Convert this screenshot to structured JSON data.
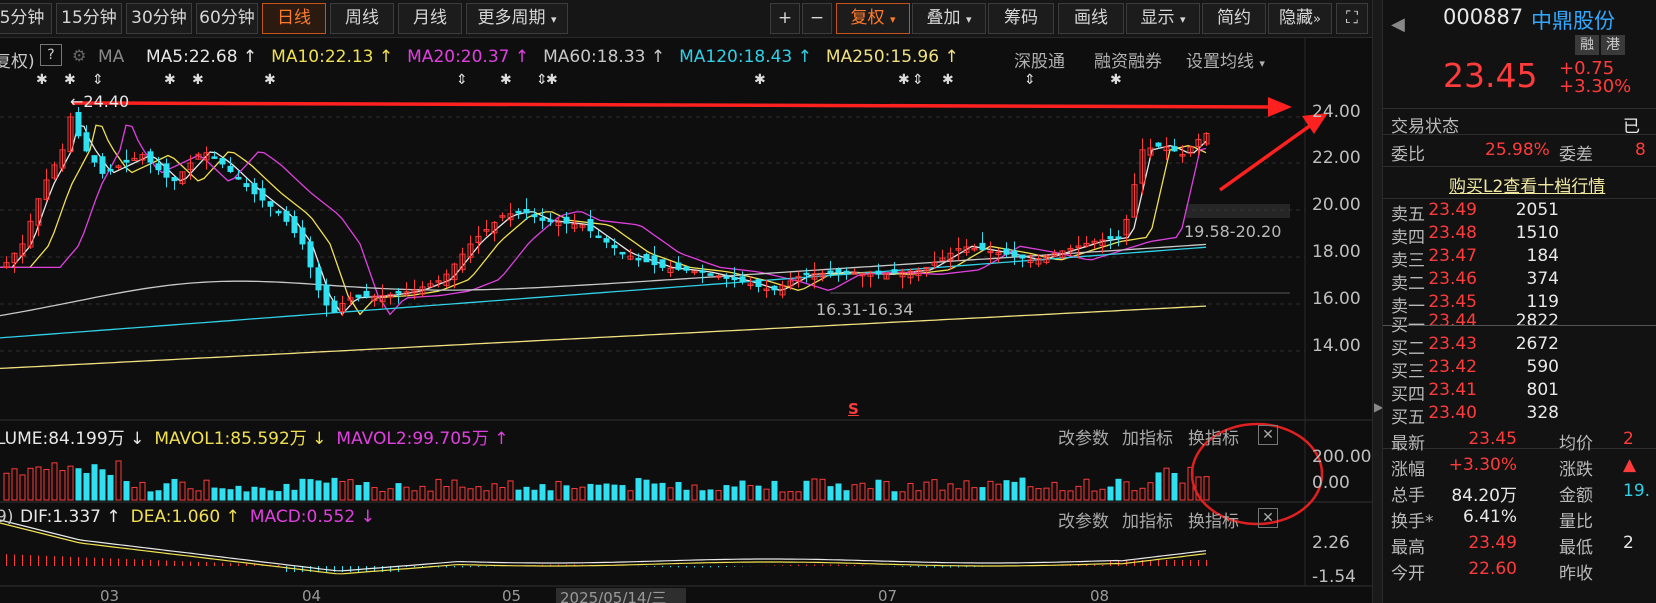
{
  "periods": {
    "items": [
      {
        "label": "5分钟"
      },
      {
        "label": "15分钟"
      },
      {
        "label": "30分钟"
      },
      {
        "label": "60分钟"
      },
      {
        "label": "日线"
      },
      {
        "label": "周线"
      },
      {
        "label": "月线"
      },
      {
        "label": "更多周期"
      }
    ],
    "active": "日线"
  },
  "toolbar": {
    "plus": "+",
    "minus": "−",
    "fuquan": "复权",
    "diejia": "叠加",
    "chouma": "筹码",
    "huaxian": "画线",
    "xianshi": "显示",
    "jianyue": "简约",
    "yincang": "隐藏"
  },
  "ma_legend": {
    "prefix": "复权)",
    "help": "?",
    "ma_label": "MA",
    "items": [
      {
        "text": "MA5:22.68",
        "arrow": "↑",
        "color": "#e8e8e8"
      },
      {
        "text": "MA10:22.13",
        "arrow": "↑",
        "color": "#f0e050"
      },
      {
        "text": "MA20:20.37",
        "arrow": "↑",
        "color": "#e040e0"
      },
      {
        "text": "MA60:18.33",
        "arrow": "↑",
        "color": "#c8c8c8"
      },
      {
        "text": "MA120:18.43",
        "arrow": "↑",
        "color": "#30d0e8"
      },
      {
        "text": "MA250:15.96",
        "arrow": "↑",
        "color": "#f0e080"
      }
    ],
    "links": [
      "深股通",
      "融资融券",
      "设置均线"
    ]
  },
  "price_axis": {
    "ticks": [
      "24.00",
      "22.00",
      "20.00",
      "18.00",
      "16.00",
      "14.00"
    ]
  },
  "annotations": {
    "high": "24.40",
    "zone1": "19.58-20.20",
    "zone2": "16.31-16.34",
    "s_mark": "S"
  },
  "volume": {
    "legend": [
      {
        "text": "LUME:84.199万",
        "arrow": "↓",
        "color": "#e8e8e8"
      },
      {
        "text": "MAVOL1:85.592万",
        "arrow": "↓",
        "color": "#f0e050"
      },
      {
        "text": "MAVOL2:99.705万",
        "arrow": "↑",
        "color": "#e040e0"
      }
    ],
    "ticks": [
      "200.00",
      "0.00"
    ],
    "buttons": [
      "改参数",
      "加指标",
      "换指标"
    ]
  },
  "macd": {
    "prefix": "9)",
    "legend": [
      {
        "text": "DIF:1.337",
        "arrow": "↑",
        "color": "#e8e8e8"
      },
      {
        "text": "DEA:1.060",
        "arrow": "↑",
        "color": "#f0e050"
      },
      {
        "text": "MACD:0.552",
        "arrow": "↓",
        "color": "#e040e0"
      }
    ],
    "ticks": [
      "2.26",
      "-1.54"
    ],
    "buttons": [
      "改参数",
      "加指标",
      "换指标"
    ]
  },
  "date_axis": {
    "labels": [
      "03",
      "04",
      "05",
      "07",
      "08"
    ],
    "cursor_date": "2025/05/14/三"
  },
  "stock": {
    "code": "000887",
    "name": "中鼎股份",
    "tag1": "融",
    "tag2": "港",
    "price": "23.45",
    "change": "+0.75",
    "change_pct": "+3.30%",
    "status_label": "交易状态",
    "status_value": "已",
    "weibi_label": "委比",
    "weibi_value": "25.98%",
    "weicha_label": "委差",
    "weicha_value": "8",
    "l2_link": "购买L2查看十档行情"
  },
  "orderbook": {
    "asks": [
      {
        "label": "卖五",
        "price": "23.49",
        "vol": "2051"
      },
      {
        "label": "卖四",
        "price": "23.48",
        "vol": "1510"
      },
      {
        "label": "卖三",
        "price": "23.47",
        "vol": "184"
      },
      {
        "label": "卖二",
        "price": "23.46",
        "vol": "374"
      },
      {
        "label": "卖一",
        "price": "23.45",
        "vol": "119"
      }
    ],
    "bids": [
      {
        "label": "买一",
        "price": "23.44",
        "vol": "2822"
      },
      {
        "label": "买二",
        "price": "23.43",
        "vol": "2672"
      },
      {
        "label": "买三",
        "price": "23.42",
        "vol": "590"
      },
      {
        "label": "买四",
        "price": "23.41",
        "vol": "801"
      },
      {
        "label": "买五",
        "price": "23.40",
        "vol": "328"
      }
    ]
  },
  "stats": [
    {
      "l1": "最新",
      "v1": "23.45",
      "c1": "#ff3b3b",
      "l2": "均价",
      "v2": "2",
      "c2": "#ff3b3b"
    },
    {
      "l1": "涨幅",
      "v1": "+3.30%",
      "c1": "#ff3b3b",
      "l2": "涨跌",
      "v2": "▲",
      "c2": "#ff3b3b"
    },
    {
      "l1": "总手",
      "v1": "84.20万",
      "c1": "#e8e8e8",
      "l2": "金额",
      "v2": "19.",
      "c2": "#30d0e8"
    },
    {
      "l1": "换手*",
      "v1": "6.41%",
      "c1": "#e8e8e8",
      "l2": "量比",
      "v2": "",
      "c2": "#e8e8e8"
    },
    {
      "l1": "最高",
      "v1": "23.49",
      "c1": "#ff3b3b",
      "l2": "最低",
      "v2": "2",
      "c2": "#e8e8e8"
    },
    {
      "l1": "今开",
      "v1": "22.60",
      "c1": "#ff3b3b",
      "l2": "昨收",
      "v2": "",
      "c2": "#e8e8e8"
    }
  ]
}
